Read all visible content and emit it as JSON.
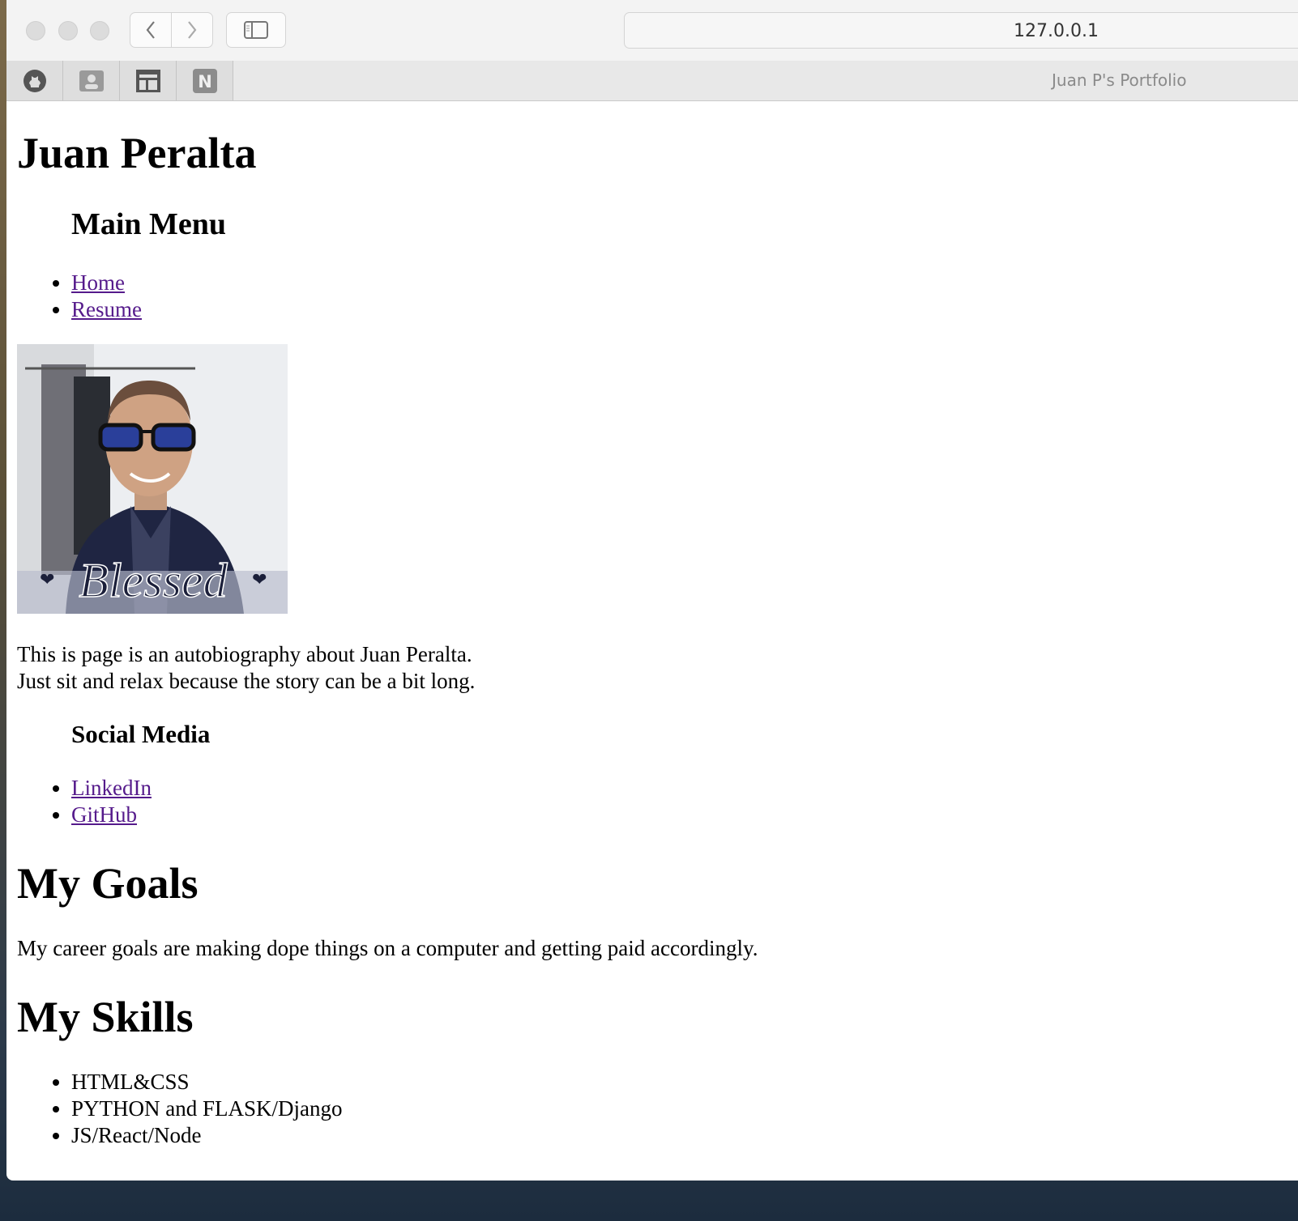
{
  "browser": {
    "address": "127.0.0.1",
    "tab_title": "Juan P's Portfolio",
    "pinned_tabs": [
      "github-icon",
      "contact-card-icon",
      "layout-icon",
      "notion-n-icon"
    ],
    "pinned_tab_letters": {
      "notion": "N"
    }
  },
  "page": {
    "title": "Juan Peralta",
    "main_menu": {
      "heading": "Main Menu",
      "links": [
        "Home",
        "Resume"
      ]
    },
    "photo": {
      "caption_art": "Blessed"
    },
    "intro": [
      "This is page is an autobiography about Juan Peralta.",
      "Just sit and relax because the story can be a bit long."
    ],
    "social": {
      "heading": "Social Media",
      "links": [
        "LinkedIn",
        "GitHub"
      ]
    },
    "goals": {
      "heading": "My Goals",
      "text": "My career goals are making dope things on a computer and getting paid accordingly."
    },
    "skills": {
      "heading": "My Skills",
      "items": [
        "HTML&CSS",
        "PYTHON and FLASK/Django",
        "JS/React/Node"
      ]
    }
  },
  "colors": {
    "link": "#551a8b",
    "titlebar": "#f3f3f3",
    "tabbar": "#e8e8e8"
  }
}
